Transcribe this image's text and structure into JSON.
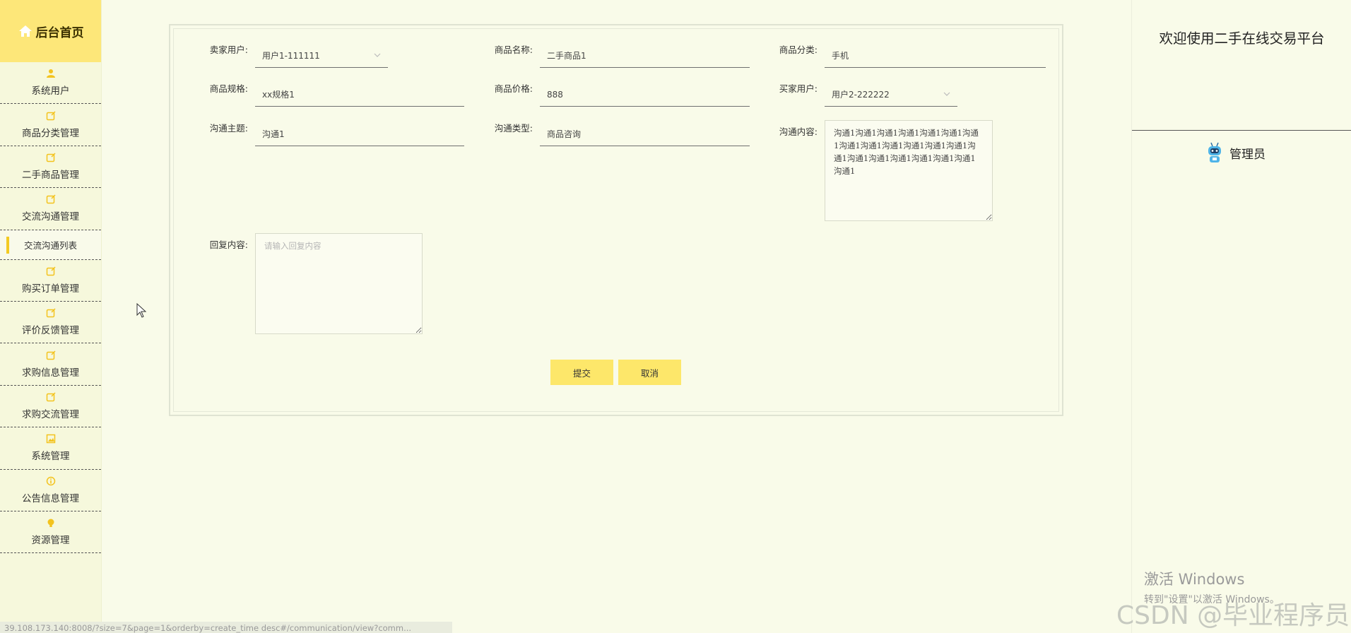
{
  "sidebar": {
    "home_label": "后台首页",
    "items": [
      {
        "label": "系统用户",
        "icon": "user-icon"
      },
      {
        "label": "商品分类管理",
        "icon": "edit-icon"
      },
      {
        "label": "二手商品管理",
        "icon": "edit-icon"
      },
      {
        "label": "交流沟通管理",
        "icon": "edit-icon"
      },
      {
        "label": "交流沟通列表",
        "icon": ""
      },
      {
        "label": "购买订单管理",
        "icon": "edit-icon"
      },
      {
        "label": "评价反馈管理",
        "icon": "edit-icon"
      },
      {
        "label": "求购信息管理",
        "icon": "edit-icon"
      },
      {
        "label": "求购交流管理",
        "icon": "edit-icon"
      },
      {
        "label": "系统管理",
        "icon": "image-icon"
      },
      {
        "label": "公告信息管理",
        "icon": "info-icon"
      },
      {
        "label": "资源管理",
        "icon": "bulb-icon"
      }
    ]
  },
  "form": {
    "seller": {
      "label": "卖家用户:",
      "value": "用户1-111111"
    },
    "product_name": {
      "label": "商品名称:",
      "value": "二手商品1"
    },
    "category": {
      "label": "商品分类:",
      "value": "手机"
    },
    "spec": {
      "label": "商品规格:",
      "value": "xx规格1"
    },
    "price": {
      "label": "商品价格:",
      "value": "888"
    },
    "buyer": {
      "label": "买家用户:",
      "value": "用户2-222222"
    },
    "topic": {
      "label": "沟通主题:",
      "value": "沟通1"
    },
    "comm_type": {
      "label": "沟通类型:",
      "value": "商品咨询"
    },
    "comm_content": {
      "label": "沟通内容:",
      "value": "沟通1沟通1沟通1沟通1沟通1沟通1沟通1沟通1沟通1沟通1沟通1沟通1沟通1沟通1沟通1沟通1沟通1沟通1沟通1沟通1沟通1"
    },
    "reply": {
      "label": "回复内容:",
      "placeholder": "请输入回复内容"
    },
    "submit_label": "提交",
    "cancel_label": "取消"
  },
  "right_panel": {
    "welcome": "欢迎使用二手在线交易平台",
    "user_name": "管理员"
  },
  "overlay": {
    "status_url": "39.108.173.140:8008/?size=7&page=1&orderby=create_time desc#/communication/view?comm...",
    "activate_title": "激活 Windows",
    "activate_hint": "转到\"设置\"以激活 Windows。",
    "watermark": "CSDN @毕业程序员"
  },
  "colors": {
    "background": "#f9fbe9",
    "accent": "#fde779",
    "button": "#fde76a",
    "active_marker": "#f3ca22"
  }
}
